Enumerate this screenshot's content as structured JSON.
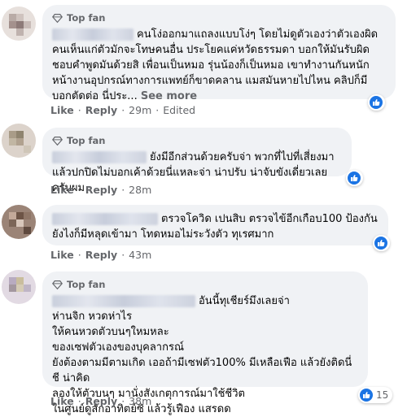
{
  "comments": [
    {
      "badge": "Top fan",
      "text_lines": "คนโง่ออกมาแถลงแบบโง่ๆ โดยไม่ดูตัวเองว่าตัวเองผิด คนเห็นแก่ตัวมักจะโทษคนอื่น ประโยคแค่หวัดธรรมดา บอกให้มันรับผิดชอบคำพูดมันด้วยสิ เพื่อนเป็นหมอ รุ่นน้องก็เป็นหมอ เขาทำงานกันหนัก หน้างานอุปกรณ์ทางการแพทย์ก็ขาดคลาน แมสมันหายไปไหน คลิปก็มีบอกตัดต่อ นี่ประ...",
      "see_more": "See more",
      "like": "Like",
      "reply": "Reply",
      "time": "29m",
      "edited": "Edited",
      "reactions": ""
    },
    {
      "badge": "Top fan",
      "text_lines": "ยังมีอีกส่วนด้วยครับจ่า พวกที่ไปที่เสี่ยงมาแล้วปกปิดไม่บอกเค้าด้วยนี่แหละจ่า น่าปรับ น่าจับขังเดี่ยวเลยครับผม",
      "like": "Like",
      "reply": "Reply",
      "time": "28m",
      "reactions": ""
    },
    {
      "text_lines": "ตรวจโควิด เปนสิบ ตรวจไข้อีกเกือบ100 ป้องกันยังไงก็มีหลุดเข้ามา โทดหมอไม่ระวังตัว ทุเรศมาก",
      "like": "Like",
      "reply": "Reply",
      "time": "43m",
      "reactions": ""
    },
    {
      "badge": "Top fan",
      "first_line": "อันนี้ทุเชียร์มึงเลยจ่า",
      "rest_lines": "ห่านจิก หวดห่าไร\nให้คนหวดตัวบนๆใหมหละ\nของเซฟตัวเองของบุคลากรณ์\nยังต้องตามมีตามเกิด เออถ้ามีเซฟตัว100% มีเหลือเฟือ แล้วยังติดนี่ชี น่าคิด\nลองให้ตัวบนๆ มานั่งสังเกตุการณ์มาใช้ชีวิต\nในศูนย์ดูสักอาทิตย์ซิ แล้วรู้เฟือง แสรดด",
      "like": "Like",
      "reply": "Reply",
      "time": "38m",
      "reactions": "15"
    }
  ],
  "colors": {
    "bubble": "#f0f2f5",
    "meta": "#65676b",
    "like_blue": "#1b74e4"
  },
  "icons": {
    "badge": "diamond-icon",
    "reaction": "thumbs-up-icon"
  }
}
